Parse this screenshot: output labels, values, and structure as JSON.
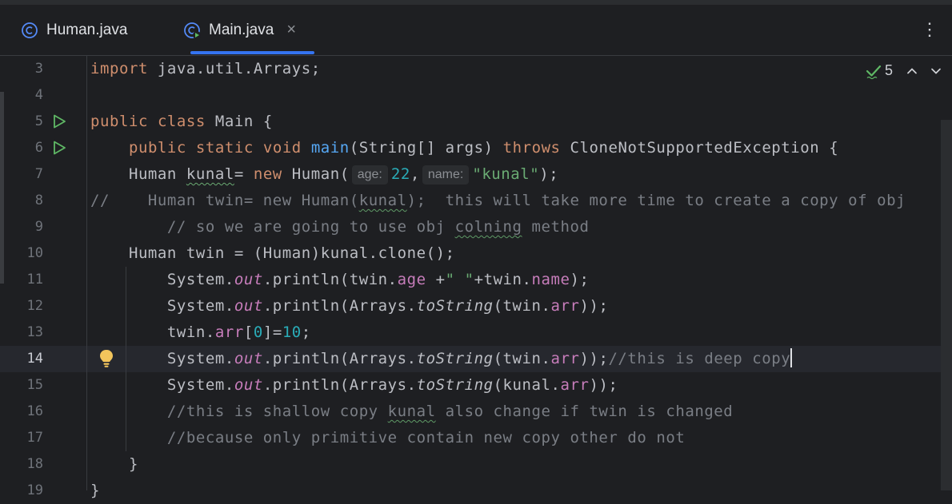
{
  "tabs": [
    {
      "label": "Human.java",
      "icon": "class-icon",
      "active": false
    },
    {
      "label": "Main.java",
      "icon": "runnable-class-icon",
      "active": true,
      "close": "×"
    }
  ],
  "menu_label": "⋮",
  "inspection": {
    "count": "5",
    "icon": "check-icon"
  },
  "lines": [
    {
      "number": "3",
      "text": "import java.util.Arrays;"
    },
    {
      "number": "4",
      "text": ""
    },
    {
      "number": "5",
      "text": "public class Main {",
      "run": true
    },
    {
      "number": "6",
      "text": "    public static void main(String[] args) throws CloneNotSupportedException {",
      "run": true
    },
    {
      "number": "7",
      "text": "    Human kunal= new Human( age: 22, name: \"kunal\");"
    },
    {
      "number": "8",
      "text": "//    Human twin= new Human(kunal);  this will take more time to create a copy of obj"
    },
    {
      "number": "9",
      "text": "        // so we are going to use obj colning method"
    },
    {
      "number": "10",
      "text": "    Human twin = (Human)kunal.clone();"
    },
    {
      "number": "11",
      "text": "        System.out.println(twin.age +\" \"+twin.name);"
    },
    {
      "number": "12",
      "text": "        System.out.println(Arrays.toString(twin.arr));"
    },
    {
      "number": "13",
      "text": "        twin.arr[0]=10;"
    },
    {
      "number": "14",
      "text": "        System.out.println(Arrays.toString(twin.arr));//this is deep copy",
      "current": true,
      "bulb": true
    },
    {
      "number": "15",
      "text": "        System.out.println(Arrays.toString(kunal.arr));"
    },
    {
      "number": "16",
      "text": "        //this is shallow copy kunal also change if twin is changed"
    },
    {
      "number": "17",
      "text": "        //because only primitive contain new copy other do not"
    },
    {
      "number": "18",
      "text": "    }"
    },
    {
      "number": "19",
      "text": "}"
    }
  ],
  "tokens": {
    "l3": [
      "import",
      " java.util.Arrays;"
    ],
    "l5": [
      "public",
      " ",
      "class",
      " Main {"
    ],
    "l6": [
      "    ",
      "public",
      " ",
      "static",
      " ",
      "void",
      " ",
      "main",
      "(String[] args) ",
      "throws",
      " CloneNotSupportedException {"
    ],
    "l7": [
      "    Human ",
      "kunal",
      "= ",
      "new",
      " Human(",
      "age:",
      "22",
      ",",
      "name:",
      "\"kunal\"",
      ");"
    ],
    "l8": [
      "//    Human twin= new Human(",
      "kunal",
      ");  this will take more time to create a copy of obj"
    ],
    "l9": [
      "        // so we are going to use obj ",
      "colning",
      " method"
    ],
    "l10": [
      "    Human twin = (Human)kunal.clone();"
    ],
    "l11": [
      "        System.",
      "out",
      ".println(twin.",
      "age",
      " +",
      "\" \"",
      "+twin.",
      "name",
      ");"
    ],
    "l12": [
      "        System.",
      "out",
      ".println(Arrays.",
      "toString",
      "(twin.",
      "arr",
      "));"
    ],
    "l13": [
      "        twin.",
      "arr",
      "[",
      "0",
      "]=",
      "10",
      ";"
    ],
    "l14": [
      "        System.",
      "out",
      ".println(Arrays.",
      "toString",
      "(twin.",
      "arr",
      "));",
      "//this is deep copy"
    ],
    "l15": [
      "        System.",
      "out",
      ".println(Arrays.",
      "toString",
      "(kunal.",
      "arr",
      "));"
    ],
    "l16": [
      "        //this is shallow copy ",
      "kunal",
      " also change if twin is changed"
    ],
    "l17": [
      "        //because only primitive contain new copy other do not"
    ],
    "l18": [
      "    }"
    ],
    "l19": [
      "}"
    ]
  },
  "colors": {
    "background": "#1e1f22",
    "keyword": "#cf8e6d",
    "method": "#56a8f5",
    "string": "#6aab73",
    "number": "#2aacb8",
    "field": "#c77dbb",
    "comment": "#7a7e85",
    "accent": "#3574f0"
  }
}
